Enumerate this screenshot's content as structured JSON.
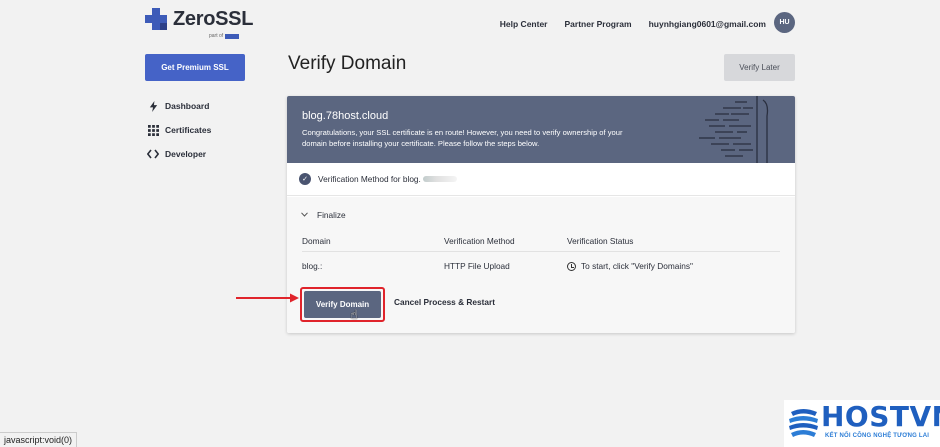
{
  "header": {
    "brand": "ZeroSSL",
    "brand_sub": "part of",
    "nav": [
      "Help Center",
      "Partner Program"
    ],
    "email": "huynhgiang0601@gmail.com",
    "avatar": "HU"
  },
  "sidebar": {
    "premium_label": "Get Premium SSL",
    "items": [
      {
        "label": "Dashboard",
        "icon": "lightning-icon"
      },
      {
        "label": "Certificates",
        "icon": "grid-icon"
      },
      {
        "label": "Developer",
        "icon": "code-icon"
      }
    ]
  },
  "main": {
    "title": "Verify Domain",
    "verify_later": "Verify Later",
    "banner": {
      "domain": "blog.78host.cloud",
      "message": "Congratulations, your SSL certificate is en route! However, you need to verify ownership of your domain before installing your certificate. Please follow the steps below."
    },
    "step1_label": "Verification Method for blog.",
    "step2_label": "Finalize",
    "table": {
      "headers": [
        "Domain",
        "Verification Method",
        "Verification Status"
      ],
      "row": {
        "domain": "blog.:",
        "method": "HTTP File Upload",
        "status": "To start, click \"Verify Domains\""
      }
    },
    "verify_btn": "Verify Domain",
    "cancel_btn": "Cancel Process & Restart"
  },
  "statusbar": "javascript:void(0)",
  "watermark": {
    "name": "HOSTVN",
    "tagline": "KẾT NỐI CÔNG NGHỆ TƯƠNG LAI"
  },
  "colors": {
    "accent": "#4563c7",
    "banner": "#5b6680",
    "highlight": "#e0242b"
  }
}
